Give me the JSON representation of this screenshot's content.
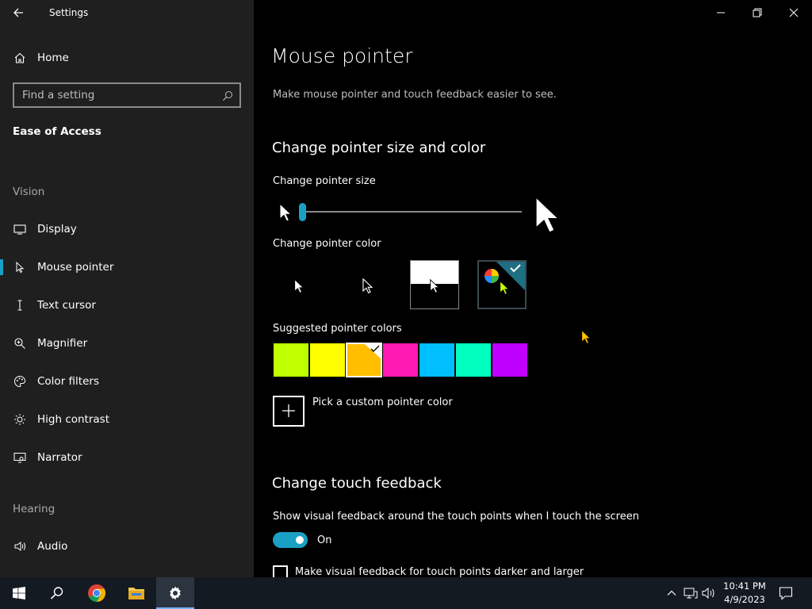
{
  "window": {
    "app_title": "Settings"
  },
  "sidebar": {
    "home_label": "Home",
    "search_placeholder": "Find a setting",
    "section_title": "Ease of Access",
    "groups": {
      "vision": "Vision",
      "hearing": "Hearing"
    },
    "items": [
      {
        "label": "Display",
        "icon": "display-icon"
      },
      {
        "label": "Mouse pointer",
        "icon": "mouse-pointer-icon",
        "selected": true
      },
      {
        "label": "Text cursor",
        "icon": "text-cursor-icon"
      },
      {
        "label": "Magnifier",
        "icon": "magnifier-icon"
      },
      {
        "label": "Color filters",
        "icon": "color-filters-icon"
      },
      {
        "label": "High contrast",
        "icon": "high-contrast-icon"
      },
      {
        "label": "Narrator",
        "icon": "narrator-icon"
      },
      {
        "label": "Audio",
        "icon": "audio-icon"
      }
    ]
  },
  "main": {
    "title": "Mouse pointer",
    "description": "Make mouse pointer and touch feedback easier to see.",
    "size_color": {
      "heading": "Change pointer size and color",
      "size_label": "Change pointer size",
      "size_value": 1,
      "color_label": "Change pointer color",
      "color_options": [
        {
          "name": "white",
          "selected": false
        },
        {
          "name": "black",
          "selected": false
        },
        {
          "name": "inverted",
          "selected": false
        },
        {
          "name": "custom",
          "selected": true
        }
      ],
      "suggested_label": "Suggested pointer colors",
      "suggested_colors": [
        "#bfff00",
        "#ffff00",
        "#ffbf00",
        "#ff1ab3",
        "#00bfff",
        "#00ffbf",
        "#bf00ff"
      ],
      "suggested_selected_index": 2,
      "custom_label": "Pick a custom pointer color"
    },
    "touch": {
      "heading": "Change touch feedback",
      "show_feedback_label": "Show visual feedback around the touch points when I touch the screen",
      "toggle_state": "On",
      "darker_label": "Make visual feedback for touch points darker and larger"
    }
  },
  "taskbar": {
    "time": "10:41 PM",
    "date": "4/9/2023"
  },
  "colors": {
    "accent": "#1aa0c4",
    "sidebar_bg": "#1f1f1f",
    "taskbar_bg": "#141a22",
    "content_bg": "#000000"
  }
}
